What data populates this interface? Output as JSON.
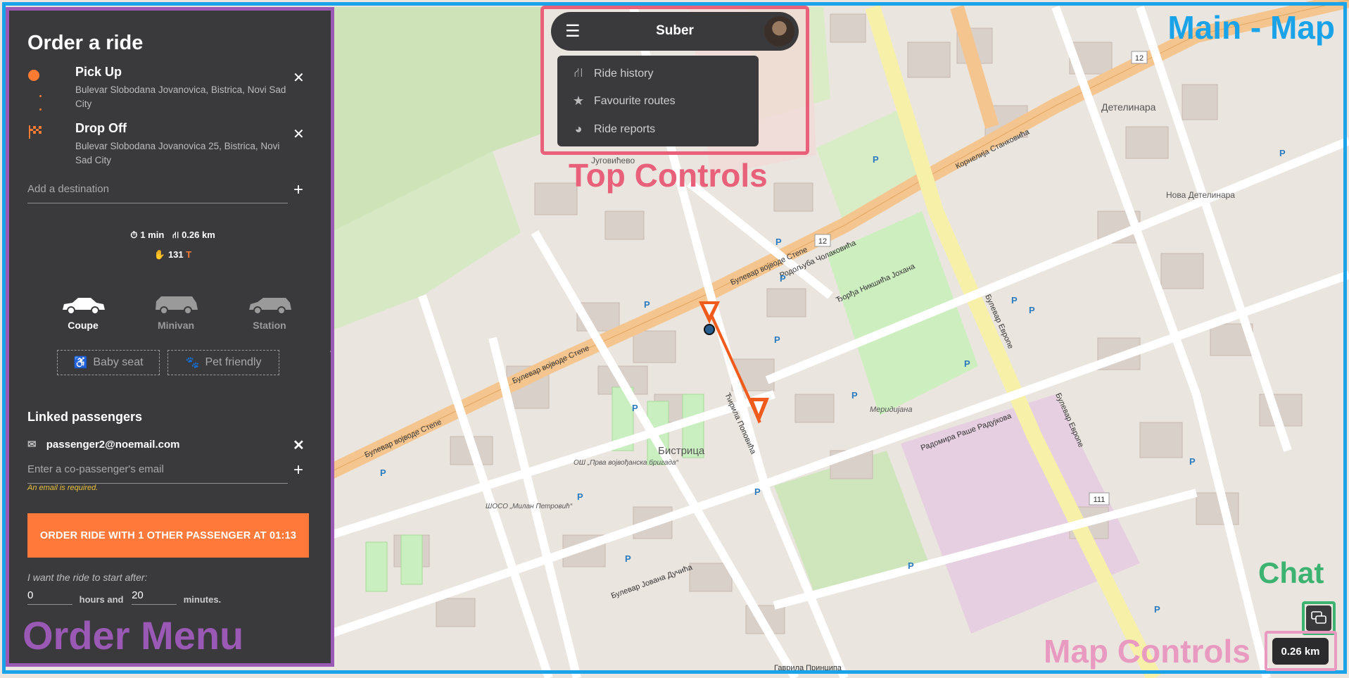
{
  "annotations": {
    "main_map": "Main - Map",
    "top_controls": "Top Controls",
    "order_menu": "Order Menu",
    "chat": "Chat",
    "map_controls": "Map Controls"
  },
  "order_panel": {
    "title": "Order a ride",
    "pickup": {
      "label": "Pick Up",
      "address": "Bulevar Slobodana Jovanovica, Bistrica, Novi Sad City",
      "icon": "circle-pin-icon"
    },
    "dropoff": {
      "label": "Drop Off",
      "address": "Bulevar Slobodana Jovanovica 25, Bistrica, Novi Sad City",
      "icon": "checkered-flag-icon"
    },
    "destination_placeholder": "Add a destination",
    "stats": {
      "duration": "1 min",
      "distance": "0.26 km",
      "price": "131",
      "currency": "T"
    },
    "vehicles": [
      {
        "label": "Coupe",
        "selected": true
      },
      {
        "label": "Minivan",
        "selected": false
      },
      {
        "label": "Station",
        "selected": false
      }
    ],
    "options": {
      "baby_seat": "Baby seat",
      "pet_friendly": "Pet friendly"
    },
    "linked_title": "Linked passengers",
    "linked_email": "passenger2@noemail.com",
    "copassenger_placeholder": "Enter a co-passenger's email",
    "error": "An email is required.",
    "order_button": "ORDER RIDE WITH 1 OTHER PASSENGER AT 01:13",
    "start_label": "I want the ride to start after:",
    "hours_value": "0",
    "hours_label": "hours and",
    "minutes_value": "20",
    "minutes_label": "minutes."
  },
  "top_bar": {
    "brand": "Suber",
    "menu": [
      {
        "label": "Ride history",
        "icon": "route-icon"
      },
      {
        "label": "Favourite routes",
        "icon": "star-icon"
      },
      {
        "label": "Ride reports",
        "icon": "pie-chart-icon"
      }
    ]
  },
  "map": {
    "streets": [
      "Булевар војводе Степе",
      "Булевар војводе Степе",
      "Булевар војводе Степе",
      "Булевар Европе",
      "Булевар Европе",
      "Корнелија Станковића",
      "Радомира Раше Радујкова",
      "Булевар Јована Дучића",
      "Родољуба Чолаковића",
      "Ђорђа Никшића Јохана",
      "Ћирила Поповића"
    ],
    "places": [
      "Бистрица",
      "Детелинара",
      "Нова Детелинара",
      "Југовићево",
      "Меридијана",
      "ОШ „Прва војвођанска бригада“",
      "ШОСО „Милан Петровић“",
      "Гаврила Принципа"
    ],
    "route_badges": [
      "12",
      "12",
      "111"
    ],
    "colors": {
      "road_major": "#f5c58f",
      "road_minor": "#ffffff",
      "park": "#cfe9bd",
      "building": "#d9d0c9",
      "route": "#f05a1a"
    }
  },
  "map_controls": {
    "scale": "0.26 km"
  }
}
